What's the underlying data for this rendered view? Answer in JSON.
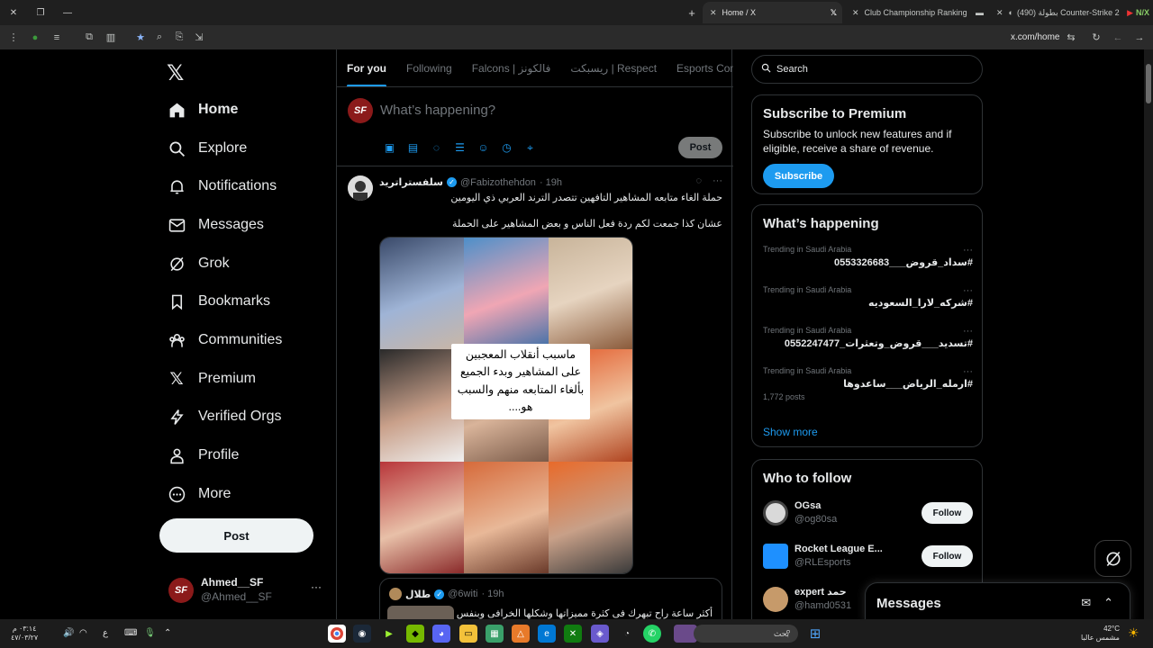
{
  "browser": {
    "tabs": [
      {
        "title": "Home / X",
        "active": true
      },
      {
        "title": "Club Championship Ranking",
        "active": false
      },
      {
        "title": "(490) بطولة Counter-Strike 2",
        "active": false
      }
    ],
    "new_tab_label": "+",
    "url": "x.com/home"
  },
  "nav": {
    "items": [
      {
        "label": "Home",
        "icon": "home-icon"
      },
      {
        "label": "Explore",
        "icon": "search-icon"
      },
      {
        "label": "Notifications",
        "icon": "bell-icon"
      },
      {
        "label": "Messages",
        "icon": "envelope-icon"
      },
      {
        "label": "Grok",
        "icon": "grok-icon"
      },
      {
        "label": "Bookmarks",
        "icon": "bookmark-icon"
      },
      {
        "label": "Communities",
        "icon": "communities-icon"
      },
      {
        "label": "Premium",
        "icon": "x-logo-icon"
      },
      {
        "label": "Verified Orgs",
        "icon": "lightning-icon"
      },
      {
        "label": "Profile",
        "icon": "person-icon"
      },
      {
        "label": "More",
        "icon": "more-circle-icon"
      }
    ],
    "post_label": "Post"
  },
  "account": {
    "display_name": "Ahmed__SF",
    "handle": "@Ahmed__SF",
    "avatar_text": "SF"
  },
  "feed": {
    "tabs": [
      "For you",
      "Following",
      "Falcons | فالكونز",
      "ريسبكت | Respect",
      "Esports Commu"
    ],
    "composer_placeholder": "What’s happening?",
    "composer_post_label": "Post",
    "tweet": {
      "name": "سلفستراتريد",
      "handle": "@Fabizothehdon",
      "time": "· 19h",
      "line1": "حملة الغاء متابعه المشاهير التافهين تتصدر الترند  العربي ذي اليومين",
      "line2": "عشان كذا جمعت لكم ردة فعل الناس و بعض المشاهير على الحملة",
      "overlay": "ماسبب أنقلاب المعجبين على المشاهير وبدء الجميع بألغاء المتابعه منهم والسبب هو....",
      "quote": {
        "name": "طلال",
        "handle": "@6witi",
        "time": "· 19h",
        "text": "أكثر ساعة راح تبهرك فى كثرة مميزاتها وشكلها الخرافى وبنفس"
      }
    }
  },
  "sidebar": {
    "search_placeholder": "Search",
    "premium": {
      "title": "Subscribe to Premium",
      "text": "Subscribe to unlock new features and if eligible, receive a share of revenue.",
      "button": "Subscribe"
    },
    "happening": {
      "title": "What’s happening",
      "trends": [
        {
          "category": "Trending in Saudi Arabia",
          "name": "#سداد_قروض___0553326683",
          "count": ""
        },
        {
          "category": "Trending in Saudi Arabia",
          "name": "#شركه_لارا_السعوديه",
          "count": ""
        },
        {
          "category": "Trending in Saudi Arabia",
          "name": "#تسديد___قروض_وتعثرات_0552247477",
          "count": ""
        },
        {
          "category": "Trending in Saudi Arabia",
          "name": "#ارمله_الرياض___ساعدوها",
          "count": "1,772 posts"
        }
      ],
      "show_more": "Show more"
    },
    "who_to_follow": {
      "title": "Who to follow",
      "accounts": [
        {
          "name": "OGsa",
          "handle": "@og80sa",
          "button": "Follow",
          "color": "#d9d9d9"
        },
        {
          "name": "Rocket League E...",
          "handle": "@RLEsports",
          "button": "Follow",
          "color": "#1e90ff"
        },
        {
          "name": "expert حمد",
          "handle": "@hamd0531",
          "button": "Follow",
          "color": "#c69a6a"
        }
      ]
    }
  },
  "messages_drawer": {
    "title": "Messages"
  },
  "taskbar": {
    "search_text": "بحث",
    "weather_temp": "42°C",
    "weather_text": "مشمس عالبا",
    "time": "٠٣:١٤ م",
    "date": "٤٧/٠٣/٢٧",
    "lang": "ع"
  },
  "colors": {
    "accent": "#1d9bf0",
    "background": "#000000",
    "border": "#2f3336",
    "muted": "#71767b"
  }
}
